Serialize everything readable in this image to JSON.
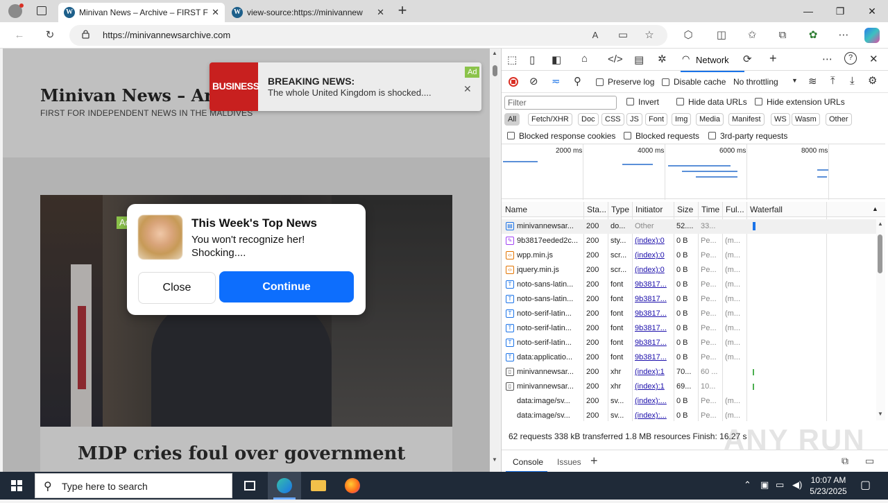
{
  "browser": {
    "tabs": [
      {
        "title": "Minivan News – Archive – FIRST F",
        "active": true
      },
      {
        "title": "view-source:https://minivannew",
        "active": false
      }
    ],
    "url": "https://minivannewsarchive.com",
    "new_tab": "+",
    "window": {
      "minimize": "—",
      "maximize": "❐",
      "close": "✕"
    }
  },
  "page": {
    "site_title": "Minivan News – Archive",
    "tagline": "FIRST FOR INDEPENDENT NEWS IN THE MALDIVES",
    "article_title": "MDP cries foul over government",
    "breaking": {
      "logo": "BUSINESS",
      "title": "BREAKING NEWS:",
      "text": "The whole United Kingdom is shocked....",
      "ad_label": "Ad",
      "close": "✕"
    },
    "popup": {
      "ad_label": "Ad",
      "title": "This Week's Top News",
      "text": "You won't recognize her! Shocking....",
      "close_label": "Close",
      "continue_label": "Continue"
    }
  },
  "devtools": {
    "active_tab": "Network",
    "controls": {
      "preserve_log": "Preserve log",
      "disable_cache": "Disable cache",
      "throttling": "No throttling"
    },
    "filter_placeholder": "Filter",
    "filter_options": {
      "invert": "Invert",
      "hide_data_urls": "Hide data URLs",
      "hide_extension_urls": "Hide extension URLs"
    },
    "type_filters": [
      "All",
      "Fetch/XHR",
      "Doc",
      "CSS",
      "JS",
      "Font",
      "Img",
      "Media",
      "Manifest",
      "WS",
      "Wasm",
      "Other"
    ],
    "block_filters": {
      "blocked_cookies": "Blocked response cookies",
      "blocked_requests": "Blocked requests",
      "third_party": "3rd-party requests"
    },
    "timeline_ticks": [
      "2000 ms",
      "4000 ms",
      "6000 ms",
      "8000 ms"
    ],
    "columns": [
      "Name",
      "Sta...",
      "Type",
      "Initiator",
      "Size",
      "Time",
      "Ful...",
      "Waterfall"
    ],
    "requests": [
      {
        "name": "minivannewsar...",
        "status": "200",
        "type": "do...",
        "initiator": "Other",
        "size": "52....",
        "time": "33...",
        "full": "",
        "icon": "doc"
      },
      {
        "name": "9b3817eeded2c...",
        "status": "200",
        "type": "sty...",
        "initiator": "(index):0",
        "size": "0 B",
        "time": "Pe...",
        "full": "(m...",
        "icon": "css"
      },
      {
        "name": "wpp.min.js",
        "status": "200",
        "type": "scr...",
        "initiator": "(index):0",
        "size": "0 B",
        "time": "Pe...",
        "full": "(m...",
        "icon": "js"
      },
      {
        "name": "jquery.min.js",
        "status": "200",
        "type": "scr...",
        "initiator": "(index):0",
        "size": "0 B",
        "time": "Pe...",
        "full": "(m...",
        "icon": "js"
      },
      {
        "name": "noto-sans-latin...",
        "status": "200",
        "type": "font",
        "initiator": "9b3817...",
        "size": "0 B",
        "time": "Pe...",
        "full": "(m...",
        "icon": "font"
      },
      {
        "name": "noto-sans-latin...",
        "status": "200",
        "type": "font",
        "initiator": "9b3817...",
        "size": "0 B",
        "time": "Pe...",
        "full": "(m...",
        "icon": "font"
      },
      {
        "name": "noto-serif-latin...",
        "status": "200",
        "type": "font",
        "initiator": "9b3817...",
        "size": "0 B",
        "time": "Pe...",
        "full": "(m...",
        "icon": "font"
      },
      {
        "name": "noto-serif-latin...",
        "status": "200",
        "type": "font",
        "initiator": "9b3817...",
        "size": "0 B",
        "time": "Pe...",
        "full": "(m...",
        "icon": "font"
      },
      {
        "name": "noto-serif-latin...",
        "status": "200",
        "type": "font",
        "initiator": "9b3817...",
        "size": "0 B",
        "time": "Pe...",
        "full": "(m...",
        "icon": "font"
      },
      {
        "name": "data:applicatio...",
        "status": "200",
        "type": "font",
        "initiator": "9b3817...",
        "size": "0 B",
        "time": "Pe...",
        "full": "(m...",
        "icon": "font"
      },
      {
        "name": "minivannewsar...",
        "status": "200",
        "type": "xhr",
        "initiator": "(index):1",
        "size": "70...",
        "time": "60 ...",
        "full": "",
        "icon": "xhr"
      },
      {
        "name": "minivannewsar...",
        "status": "200",
        "type": "xhr",
        "initiator": "(index):1",
        "size": "69...",
        "time": "10...",
        "full": "",
        "icon": "xhr"
      },
      {
        "name": "data:image/sv...",
        "status": "200",
        "type": "sv...",
        "initiator": "(index):...",
        "size": "0 B",
        "time": "Pe...",
        "full": "(m...",
        "icon": "none"
      },
      {
        "name": "data:image/sv...",
        "status": "200",
        "type": "sv...",
        "initiator": "(index):...",
        "size": "0 B",
        "time": "Pe...",
        "full": "(m...",
        "icon": "none"
      }
    ],
    "summary": "62 requests  338 kB transferred  1.8 MB resources  Finish: 16.27 s",
    "drawer_tabs": {
      "console": "Console",
      "issues": "Issues"
    }
  },
  "taskbar": {
    "search_placeholder": "Type here to search",
    "time": "10:07 AM",
    "date": "5/23/2025"
  },
  "watermark": "ANY RUN",
  "colors": {
    "accent": "#1a73e8",
    "continue_button": "#0d6efd",
    "ad_tag": "#8bc34a",
    "breaking_logo": "#c8201f"
  }
}
